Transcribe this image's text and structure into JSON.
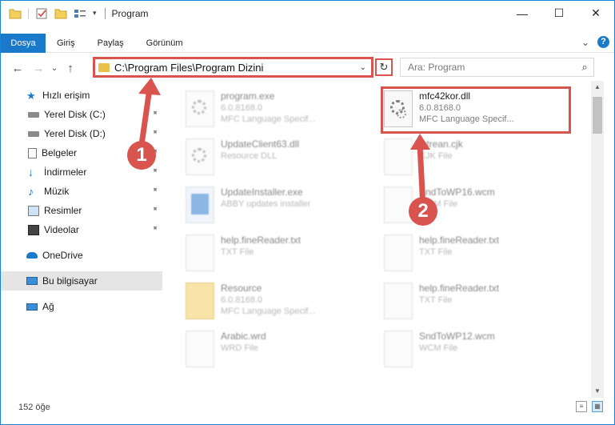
{
  "window": {
    "title": "Program"
  },
  "controls": {
    "minimize": "—",
    "maximize": "☐",
    "close": "✕"
  },
  "ribbon": {
    "tabs": [
      {
        "label": "Dosya",
        "active": true
      },
      {
        "label": "Giriş"
      },
      {
        "label": "Paylaş"
      },
      {
        "label": "Görünüm"
      }
    ],
    "expand_glyph": "⌄",
    "help_glyph": "?"
  },
  "nav": {
    "back": "←",
    "forward": "→",
    "recent": "⌄",
    "up": "↑",
    "address": "C:\\Program Files\\Program Dizini",
    "address_dropdown": "⌄",
    "refresh": "↻",
    "search_placeholder": "Ara: Program",
    "search_glyph": "⌕"
  },
  "sidebar": {
    "items": [
      {
        "label": "Hızlı erişim",
        "icon": "star-icon",
        "top": true
      },
      {
        "label": "Yerel Disk (C:)",
        "icon": "drive-icon",
        "pinned": true
      },
      {
        "label": "Yerel Disk (D:)",
        "icon": "drive-icon",
        "pinned": true
      },
      {
        "label": "Belgeler",
        "icon": "documents-icon",
        "pinned": true
      },
      {
        "label": "İndirmeler",
        "icon": "download-icon",
        "pinned": true
      },
      {
        "label": "Müzik",
        "icon": "music-icon",
        "pinned": true
      },
      {
        "label": "Resimler",
        "icon": "pictures-icon",
        "pinned": true
      },
      {
        "label": "Videolar",
        "icon": "videos-icon",
        "pinned": true
      },
      {
        "label": "OneDrive",
        "icon": "cloud-icon",
        "top": true
      },
      {
        "label": "Bu bilgisayar",
        "icon": "computer-icon",
        "top": true,
        "selected": true
      },
      {
        "label": "Ağ",
        "icon": "network-icon",
        "top": true
      }
    ],
    "pin_glyph": "📌"
  },
  "files": [
    {
      "name": "program.exe",
      "line1": "6.0.8168.0",
      "line2": "MFC Language Specif...",
      "col": 0,
      "row": 0,
      "blur": true
    },
    {
      "name": "mfc42kor.dll",
      "line1": "6.0.8168.0",
      "line2": "MFC Language Specif...",
      "col": 1,
      "row": 0,
      "blur": false
    },
    {
      "name": "UpdateClient63.dll",
      "line1": "Resource DLL",
      "line2": "",
      "col": 0,
      "row": 1,
      "blur": true
    },
    {
      "name": "lutrean.cjk",
      "line1": "CJK File",
      "line2": "",
      "col": 1,
      "row": 1,
      "blur": true
    },
    {
      "name": "UpdateInstaller.exe",
      "line1": "ABBY updates installer",
      "line2": "",
      "col": 0,
      "row": 2,
      "blur": true
    },
    {
      "name": "SndToWP16.wcm",
      "line1": "WCM File",
      "line2": "",
      "col": 1,
      "row": 2,
      "blur": true
    },
    {
      "name": "help.fineReader.txt",
      "line1": "TXT File",
      "line2": "",
      "col": 0,
      "row": 3,
      "blur": true
    },
    {
      "name": "help.fineReader.txt",
      "line1": "TXT File",
      "line2": "",
      "col": 1,
      "row": 3,
      "blur": true
    },
    {
      "name": "Resource",
      "line1": "6.0.8168.0",
      "line2": "MFC Language Specif...",
      "col": 0,
      "row": 4,
      "blur": true
    },
    {
      "name": "help.fineReader.txt",
      "line1": "TXT File",
      "line2": "",
      "col": 1,
      "row": 4,
      "blur": true
    },
    {
      "name": "Arabic.wrd",
      "line1": "WRD File",
      "line2": "",
      "col": 0,
      "row": 5,
      "blur": true
    },
    {
      "name": "SndToWP12.wcm",
      "line1": "WCM File",
      "line2": "",
      "col": 1,
      "row": 5,
      "blur": true
    }
  ],
  "annotations": {
    "step1": "1",
    "step2": "2"
  },
  "scrollbar": {
    "up": "▲",
    "down": "▼"
  },
  "status": {
    "count": "152 öğe",
    "details_view": "≡",
    "icon_view": "▦"
  },
  "colors": {
    "accent": "#1979ca",
    "highlight": "#d9534f",
    "folder": "#e8c04a"
  }
}
